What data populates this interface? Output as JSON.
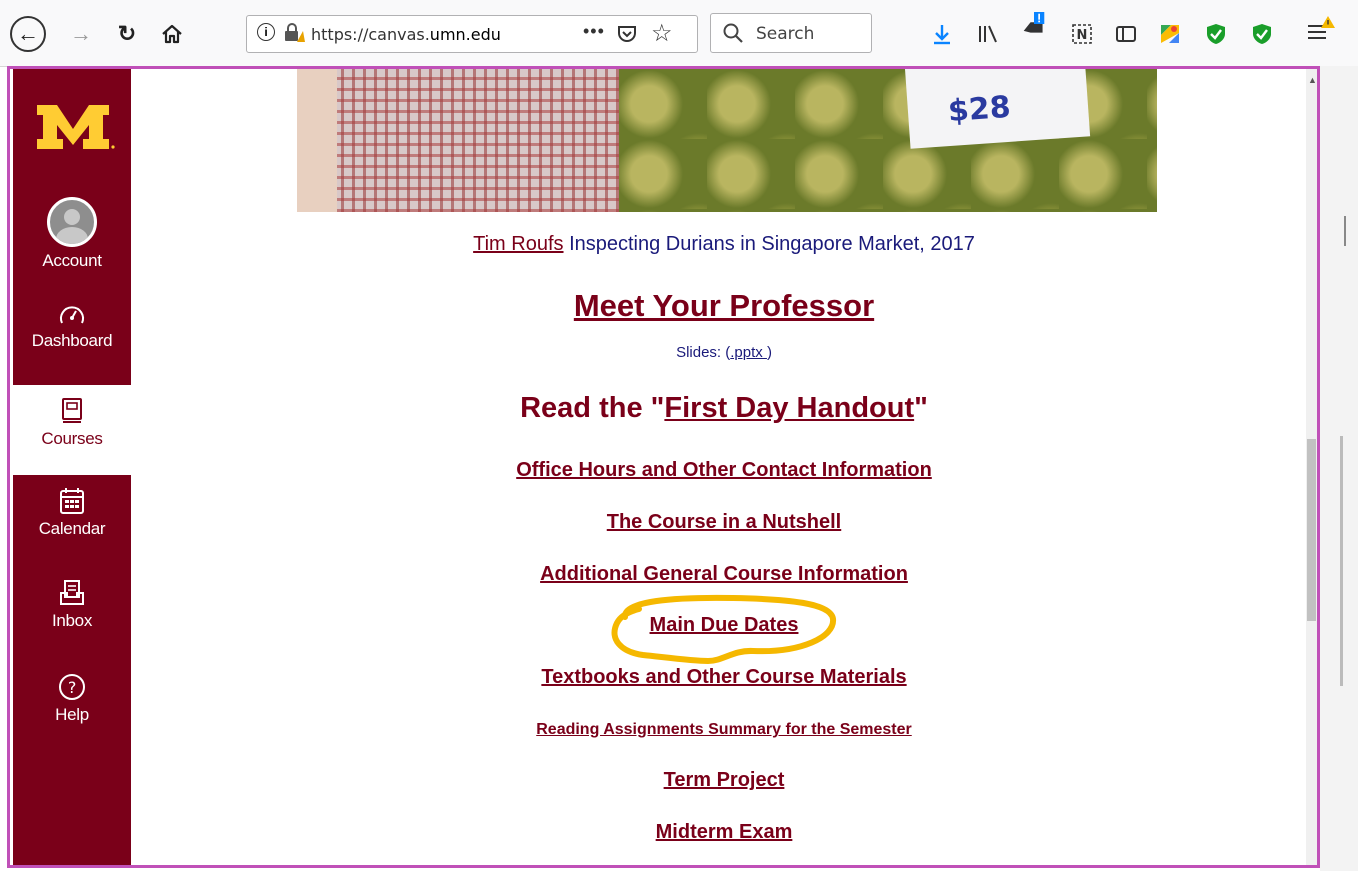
{
  "browser": {
    "url_prefix": "https://canvas.",
    "url_domain": "umn.edu",
    "search_placeholder": "Search",
    "more_glyph": "•••"
  },
  "nav": {
    "items": [
      {
        "label": "Account"
      },
      {
        "label": "Dashboard"
      },
      {
        "label": "Courses"
      },
      {
        "label": "Calendar"
      },
      {
        "label": "Inbox"
      },
      {
        "label": "Help"
      }
    ]
  },
  "content": {
    "caption_name": "Tim Roufs",
    "caption_rest": " Inspecting Durians in Singapore Market, 2017",
    "price_sign": "$28",
    "meet_heading": "Meet Your Professor",
    "slides_prefix": "Slides: (",
    "slides_link": ".pptx ",
    "slides_suffix": ")",
    "read_prefix": "Read the \"",
    "read_link": "First Day Handout",
    "read_suffix": "\"",
    "links": [
      "Office Hours and Other Contact Information",
      "The Course in a Nutshell",
      "Additional General Course Information",
      "Main Due Dates",
      "Textbooks and Other Course Materials",
      "Reading Assignments Summary for the Semester",
      "Term Project",
      "Midterm Exam"
    ]
  },
  "colors": {
    "umn_maroon": "#7a0019",
    "umn_gold": "#ffcc33",
    "frame_border": "#c050b8",
    "highlight": "#f5b800"
  },
  "icons": [
    "back-icon",
    "forward-icon",
    "reload-icon",
    "home-icon",
    "info-icon",
    "insecure-lock-icon",
    "pocket-icon",
    "bookmark-star-icon",
    "search-icon",
    "download-icon",
    "library-icon",
    "notification-icon",
    "onenote-icon",
    "sidebar-icon",
    "maps-icon",
    "shield-icon",
    "menu-icon"
  ]
}
